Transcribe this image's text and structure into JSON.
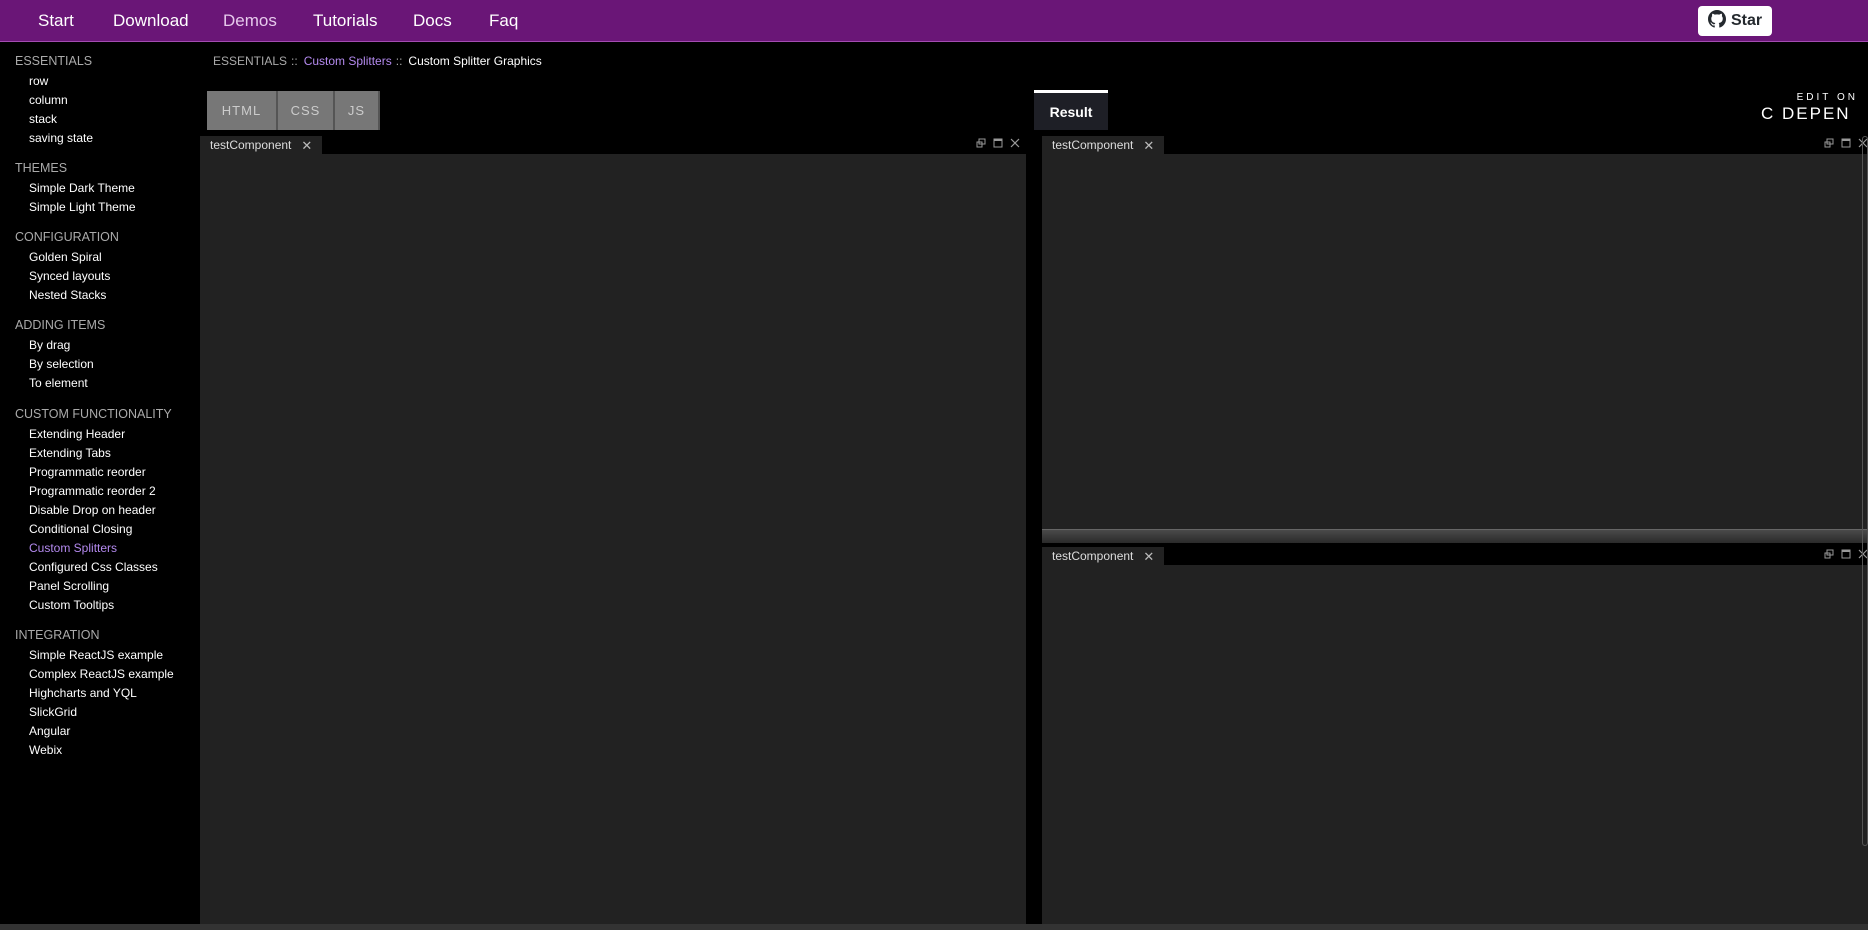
{
  "nav": {
    "items": [
      {
        "label": "Start"
      },
      {
        "label": "Download"
      },
      {
        "label": "Demos"
      },
      {
        "label": "Tutorials"
      },
      {
        "label": "Docs"
      },
      {
        "label": "Faq"
      }
    ],
    "star_label": "Star",
    "accent": "#6a1677"
  },
  "sidebar": {
    "sections": [
      {
        "title": "ESSENTIALS",
        "items": [
          "row",
          "column",
          "stack",
          "saving state"
        ]
      },
      {
        "title": "THEMES",
        "items": [
          "Simple Dark Theme",
          "Simple Light Theme"
        ]
      },
      {
        "title": "CONFIGURATION",
        "items": [
          "Golden Spiral",
          "Synced layouts",
          "Nested Stacks"
        ]
      },
      {
        "title": "ADDING ITEMS",
        "items": [
          "By drag",
          "By selection",
          "To element"
        ]
      },
      {
        "title": "CUSTOM FUNCTIONALITY",
        "items": [
          "Extending Header",
          "Extending Tabs",
          "Programmatic reorder",
          "Programmatic reorder 2",
          "Disable Drop on header",
          "Conditional Closing",
          "Custom Splitters",
          "Configured Css Classes",
          "Panel Scrolling",
          "Custom Tooltips"
        ]
      },
      {
        "title": "INTEGRATION",
        "items": [
          "Simple ReactJS example",
          "Complex ReactJS example",
          "Highcharts and YQL",
          "SlickGrid",
          "Angular",
          "Webix"
        ]
      }
    ],
    "active_item": "Custom Splitters",
    "active_color": "#b48aef"
  },
  "breadcrumb": {
    "root": "ESSENTIALS",
    "separator": "::",
    "section": "Custom Splitters",
    "current": "Custom Splitter Graphics"
  },
  "codepen": {
    "tabs": [
      "HTML",
      "CSS",
      "JS"
    ],
    "result_label": "Result",
    "edit_on": "EDIT ON",
    "logo": "C DEPEN"
  },
  "panels": {
    "left": {
      "tab_title": "testComponent"
    },
    "right_top": {
      "tab_title": "testComponent"
    },
    "right_bottom": {
      "tab_title": "testComponent"
    }
  }
}
